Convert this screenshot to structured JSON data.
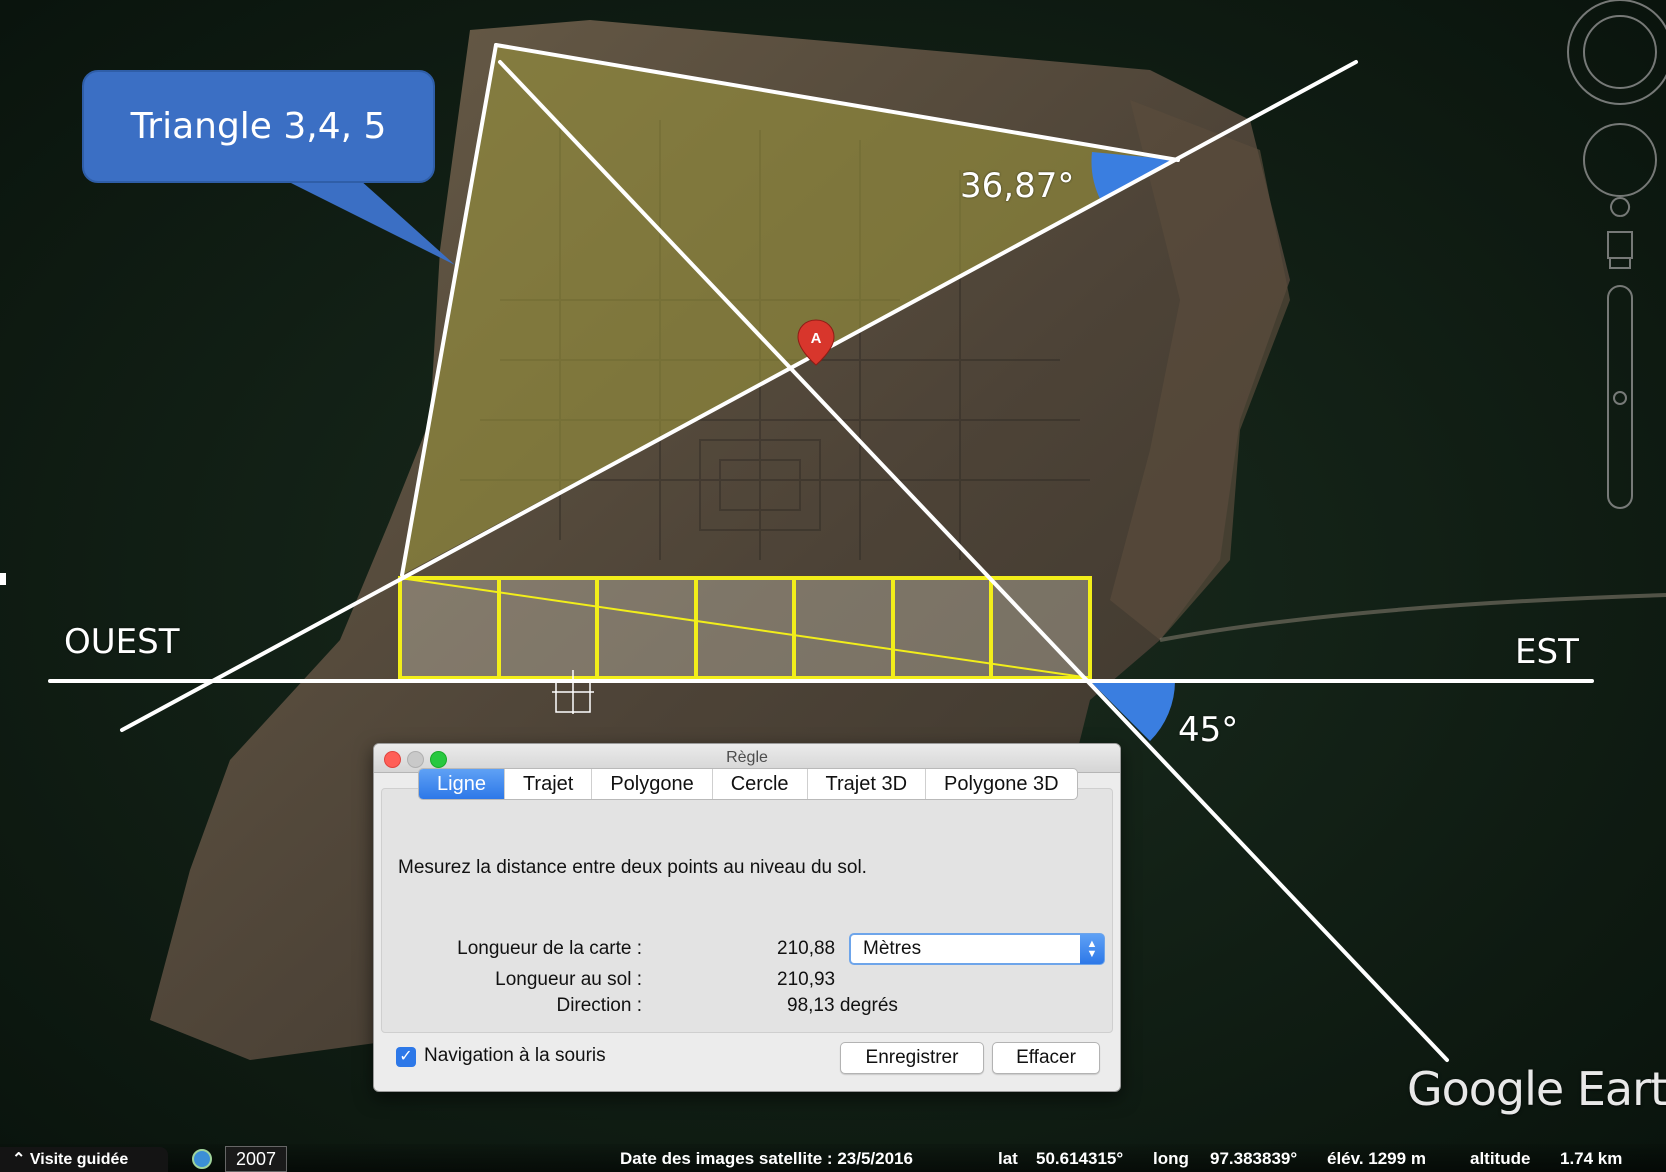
{
  "annotations": {
    "callout": "Triangle 3,4, 5",
    "angle_top": "36,87°",
    "angle_bottom": "45°",
    "west": "OUEST",
    "east": "EST",
    "marker": "A"
  },
  "dialog": {
    "title": "Règle",
    "tabs": [
      "Ligne",
      "Trajet",
      "Polygone",
      "Cercle",
      "Trajet 3D",
      "Polygone 3D"
    ],
    "active_tab": "Ligne",
    "description": "Mesurez la distance entre deux points au niveau du sol.",
    "map_length_label": "Longueur de la carte :",
    "map_length_value": "210,88",
    "unit": "Mètres",
    "ground_length_label": "Longueur au sol :",
    "ground_length_value": "210,93",
    "direction_label": "Direction :",
    "direction_value": "98,13 degrés",
    "navigation_checkbox": "Navigation à la souris",
    "navigation_checked": true,
    "save_button": "Enregistrer",
    "clear_button": "Effacer"
  },
  "statusbar": {
    "tour": "Visite guidée",
    "tour_icon": "chevron-up-icon",
    "year": "2007",
    "imagery_date": "Date des images satellite : 23/5/2016",
    "lat_label": "lat",
    "lat_value": "50.614315°",
    "long_label": "long",
    "long_value": "97.383839°",
    "elev": "élév. 1299 m",
    "altitude_label": "altitude",
    "altitude_value": "1.74 km"
  },
  "brand": "Google Earth",
  "colors": {
    "callout": "#3b6fc4",
    "angle_fill": "#3a7ee0",
    "triangle_fill": "#a09a3c",
    "grid": "#f2ee1a",
    "lines": "#ffffff"
  }
}
